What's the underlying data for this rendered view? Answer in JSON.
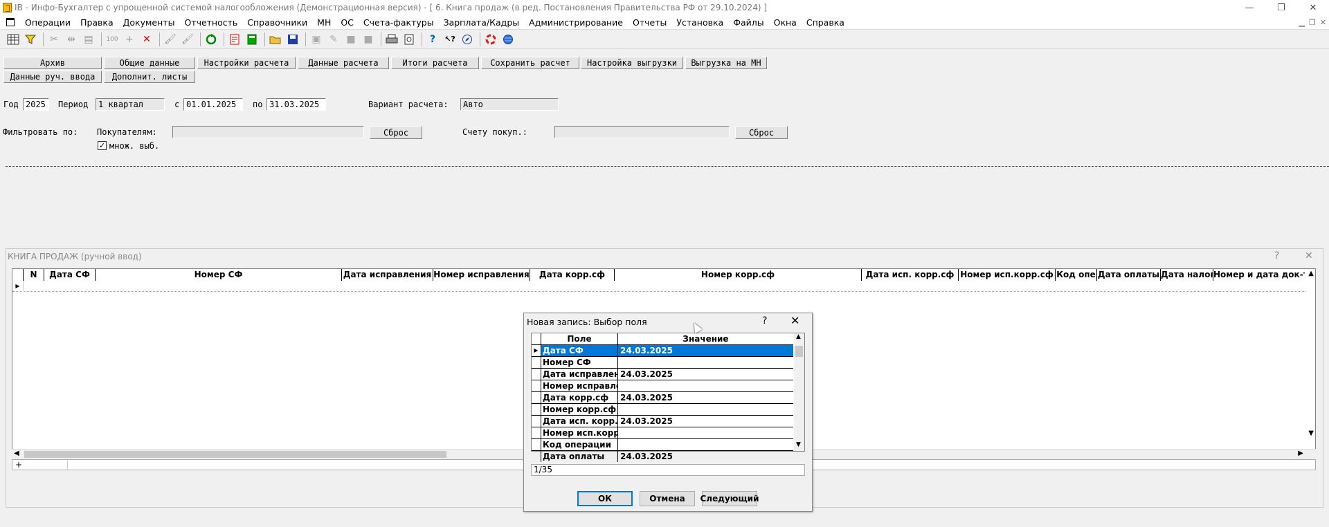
{
  "window": {
    "title": "IB - Инфо-Бухгалтер с упрощенной системой налогообложения (Демонстрационная версия) - [ 6. Книга продаж (в ред. Постановления Правительства РФ от 29.10.2024) ]",
    "minimize": "—",
    "restore": "❐",
    "close": "✕"
  },
  "menu": [
    "Операции",
    "Правка",
    "Документы",
    "Отчетность",
    "Справочники",
    "МН",
    "ОС",
    "Счета-фактуры",
    "Зарплата/Кадры",
    "Администрирование",
    "Отчеты",
    "Установка",
    "Файлы",
    "Окна",
    "Справка"
  ],
  "toolbar_icons": [
    "table-icon",
    "filter-icon",
    "cut-icon",
    "merge-icon",
    "paste-icon",
    "numbering-icon",
    "add-icon",
    "delete-icon",
    "brush-icon",
    "brush-clear-icon",
    "refresh-icon",
    "pdf-icon",
    "calculator-icon",
    "open-folder-icon",
    "save-icon",
    "image-icon",
    "edit-icon",
    "block-icon",
    "block2-icon",
    "print-icon",
    "preview-icon",
    "help-icon",
    "context-help-icon",
    "compass-icon",
    "lifebuoy-icon",
    "globe-icon"
  ],
  "tabs": {
    "archive": "Архив",
    "general": "Общие данные",
    "calc_settings": "Настройки расчета",
    "calc_data": "Данные расчета",
    "calc_totals": "Итоги расчета",
    "save_calc": "Сохранить расчет",
    "export_settings": "Настройка выгрузки",
    "export_mn": "Выгрузка на МН",
    "manual_data": "Данные руч. ввода",
    "extra_sheets": "Дополнит. листы"
  },
  "params": {
    "year_label": "Год",
    "year": "2025",
    "period_label": "Период",
    "period": "1 квартал",
    "from_label": "с",
    "from": "01.01.2025",
    "to_label": "по",
    "to": "31.03.2025",
    "variant_label": "Вариант расчета:",
    "variant": "Авто"
  },
  "filter": {
    "label": "Фильтровать по:",
    "buyers_label": "Покупателям:",
    "buyers_value": "",
    "reset1": "Сброс",
    "account_label": "Счету покуп.:",
    "account_value": "",
    "reset2": "Сброс",
    "multi_label": "множ. выб.",
    "multi_checked": true
  },
  "subwindow": {
    "title": "КНИГА ПРОДАЖ (ручной ввод)",
    "help": "?",
    "close": "✕",
    "columns": [
      "N",
      "Дата СФ",
      "Номер СФ",
      "Дата исправления",
      "Номер исправления",
      "Дата корр.сф",
      "Номер корр.сф",
      "Дата исп. корр.сф",
      "Номер исп.корр.сф",
      "Код опе",
      "Дата оплаты",
      "Дата налог.",
      "Номер и дата док-та о"
    ],
    "status": "+"
  },
  "dialog": {
    "title": "Новая запись: Выбор поля",
    "help": "?",
    "close": "✕",
    "col_field": "Поле",
    "col_value": "Значение",
    "rows": [
      {
        "field": "Дата СФ",
        "value": "24.03.2025"
      },
      {
        "field": "Номер СФ",
        "value": ""
      },
      {
        "field": "Дата исправлени",
        "value": "24.03.2025"
      },
      {
        "field": "Номер исправлен",
        "value": ""
      },
      {
        "field": "Дата корр.сф",
        "value": "24.03.2025"
      },
      {
        "field": "Номер корр.сф",
        "value": ""
      },
      {
        "field": "Дата исп. корр.с",
        "value": "24.03.2025"
      },
      {
        "field": "Номер исп.корр.с",
        "value": ""
      },
      {
        "field": "Код операции",
        "value": ""
      },
      {
        "field": "Дата оплаты",
        "value": "24.03.2025"
      }
    ],
    "counter": "1/35",
    "ok": "ОК",
    "cancel": "Отмена",
    "next": "Следующий"
  }
}
